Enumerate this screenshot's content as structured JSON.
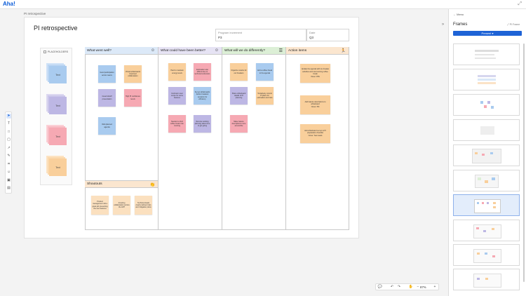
{
  "app": {
    "logo": "Aha!"
  },
  "breadcrumb": "PI retrospective",
  "page_title": "PI retrospective",
  "fields": {
    "increment_label": "Program increment",
    "increment_value": "P3",
    "date_label": "Date",
    "date_value": "Q3"
  },
  "placeholder": {
    "header": "PLACEHOLDERS",
    "stack_labels": [
      "Text",
      "Text",
      "Text",
      "Text"
    ]
  },
  "columns": {
    "went_well": "What went well?",
    "could_be_better": "What could have been better?",
    "do_differently": "What will we do differently?",
    "action_items": "Action items",
    "shoutouts": "Shoutouts"
  },
  "notes": {
    "ww1": "Good participation across teams",
    "ww2": "Virtual whiteboards improved collaboration",
    "ww3": "Great kickoff presentation",
    "ww4": "High PI confidence levels",
    "ww5": "Well-planned agenda",
    "cb1": "Hard to maintain energy levels",
    "cb2": "Estimation was difficult due to technical unknowns",
    "cb3": "Confusion over scope for some features",
    "cb4": "Set up whiteboards before breakout sessions for efficiency",
    "cb5": "Needed a short coffee break mid-morning",
    "cb6": "Remote working planning takes time to get going",
    "dd1": "Organize snacks for our breakers",
    "dd2": "Add a coffee break to the agenda",
    "dd3": "Share whiteboard details of PI planning",
    "dd4": "Tentatively commit PI plans for estimation and risks",
    "dd5": "Make feature descriptions more accessible",
    "ai1": "Update the agenda with ice breaker activities and mid-morning coffee break",
    "ai1_owner": "Owner: RTE",
    "ai2": "Add feature descriptions to whiteboard",
    "ai2_owner": "Owner: PM",
    "ai3": "Add whiteboard set up to PI preparation checklist",
    "ai3_owner": "Owner: Team leads",
    "so1": "Product management did a great job presenting the new features",
    "so2": "Amazing collaboration across the ART",
    "so3": "Technical leads clearly defined risks and mitigation plans"
  },
  "toolbar": {
    "tools": [
      "select-arrow-icon",
      "text-icon",
      "shape-icon",
      "sticky-note-icon",
      "arrow-icon",
      "pen-icon",
      "frame-icon",
      "emoji-icon",
      "image-icon",
      "embed-icon"
    ]
  },
  "zoom": {
    "level": "87%"
  },
  "sidebar": {
    "menu": "Menu",
    "frames_title": "Frames",
    "pi_frame": "PI Frame",
    "present_label": "Present ▾"
  },
  "colors": {
    "accent": "#1e63d6",
    "blue_note": "#a9cbef",
    "purple_note": "#bdb7e4",
    "pink_note": "#f6a9b3",
    "orange_note": "#f9cf9b",
    "green_header": "#dcefd6"
  }
}
